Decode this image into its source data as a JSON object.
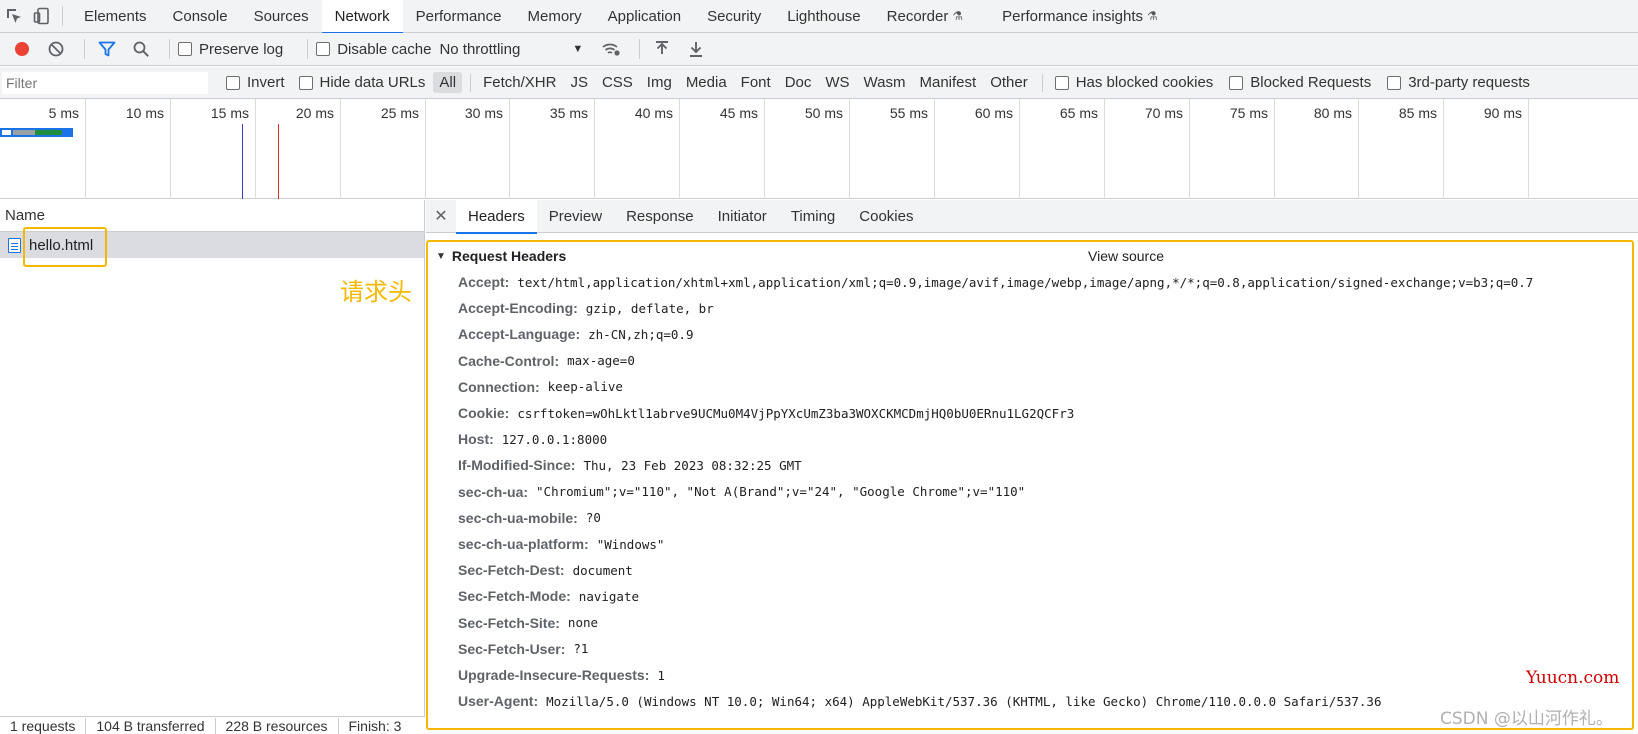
{
  "devtools_tabs": [
    {
      "label": "Elements"
    },
    {
      "label": "Console"
    },
    {
      "label": "Sources"
    },
    {
      "label": "Network",
      "active": true
    },
    {
      "label": "Performance"
    },
    {
      "label": "Memory"
    },
    {
      "label": "Application"
    },
    {
      "label": "Security"
    },
    {
      "label": "Lighthouse"
    },
    {
      "label": "Recorder",
      "experimental": true
    },
    {
      "label": "Performance insights",
      "experimental": true
    }
  ],
  "toolbar": {
    "preserve_log": "Preserve log",
    "disable_cache": "Disable cache",
    "throttling": "No throttling"
  },
  "filter": {
    "placeholder": "Filter",
    "invert": "Invert",
    "hide_data_urls": "Hide data URLs",
    "types": [
      "All",
      "Fetch/XHR",
      "JS",
      "CSS",
      "Img",
      "Media",
      "Font",
      "Doc",
      "WS",
      "Wasm",
      "Manifest",
      "Other"
    ],
    "has_blocked_cookies": "Has blocked cookies",
    "blocked_requests": "Blocked Requests",
    "third_party": "3rd-party requests"
  },
  "timeline": {
    "ticks": [
      "5 ms",
      "10 ms",
      "15 ms",
      "20 ms",
      "25 ms",
      "30 ms",
      "35 ms",
      "40 ms",
      "45 ms",
      "50 ms",
      "55 ms",
      "60 ms",
      "65 ms",
      "70 ms",
      "75 ms",
      "80 ms",
      "85 ms",
      "90 ms"
    ],
    "dom_content_loaded_ms": 15,
    "load_ms": 17
  },
  "request_list": {
    "column_name": "Name",
    "requests": [
      {
        "name": "hello.html"
      }
    ],
    "annotation": "请求头"
  },
  "status": {
    "requests": "1 requests",
    "transferred": "104 B transferred",
    "resources": "228 B resources",
    "finish": "Finish: 3"
  },
  "detail_tabs": [
    {
      "label": "Headers",
      "active": true
    },
    {
      "label": "Preview"
    },
    {
      "label": "Response"
    },
    {
      "label": "Initiator"
    },
    {
      "label": "Timing"
    },
    {
      "label": "Cookies"
    }
  ],
  "request_headers": {
    "title": "Request Headers",
    "view_source": "View source",
    "rows": [
      {
        "name": "Accept:",
        "value": "text/html,application/xhtml+xml,application/xml;q=0.9,image/avif,image/webp,image/apng,*/*;q=0.8,application/signed-exchange;v=b3;q=0.7"
      },
      {
        "name": "Accept-Encoding:",
        "value": "gzip, deflate, br"
      },
      {
        "name": "Accept-Language:",
        "value": "zh-CN,zh;q=0.9"
      },
      {
        "name": "Cache-Control:",
        "value": "max-age=0"
      },
      {
        "name": "Connection:",
        "value": "keep-alive"
      },
      {
        "name": "Cookie:",
        "value": "csrftoken=wOhLktl1abrve9UCMu0M4VjPpYXcUmZ3ba3WOXCKMCDmjHQ0bU0ERnu1LG2QCFr3"
      },
      {
        "name": "Host:",
        "value": "127.0.0.1:8000"
      },
      {
        "name": "If-Modified-Since:",
        "value": "Thu, 23 Feb 2023 08:32:25 GMT"
      },
      {
        "name": "sec-ch-ua:",
        "value": "\"Chromium\";v=\"110\", \"Not A(Brand\";v=\"24\", \"Google Chrome\";v=\"110\""
      },
      {
        "name": "sec-ch-ua-mobile:",
        "value": "?0"
      },
      {
        "name": "sec-ch-ua-platform:",
        "value": "\"Windows\""
      },
      {
        "name": "Sec-Fetch-Dest:",
        "value": "document"
      },
      {
        "name": "Sec-Fetch-Mode:",
        "value": "navigate"
      },
      {
        "name": "Sec-Fetch-Site:",
        "value": "none"
      },
      {
        "name": "Sec-Fetch-User:",
        "value": "?1"
      },
      {
        "name": "Upgrade-Insecure-Requests:",
        "value": "1"
      },
      {
        "name": "User-Agent:",
        "value": "Mozilla/5.0 (Windows NT 10.0; Win64; x64) AppleWebKit/537.36 (KHTML, like Gecko) Chrome/110.0.0.0 Safari/537.36"
      }
    ]
  },
  "watermarks": {
    "site": "Yuucn.com",
    "author": "CSDN @以山河作礼。"
  },
  "colors": {
    "accent": "#1a73e8",
    "highlight": "#f5b800",
    "record": "#ea4335"
  }
}
